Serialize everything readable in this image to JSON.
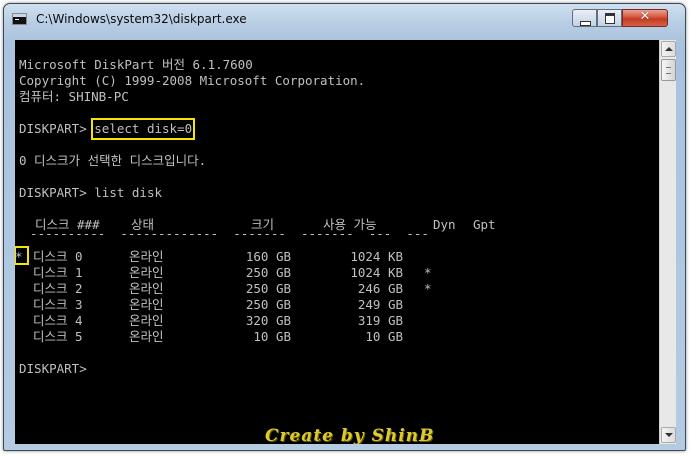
{
  "window": {
    "title": "C:\\Windows\\system32\\diskpart.exe",
    "controls": {
      "minimize": "–",
      "maximize": "□",
      "close": "✕"
    }
  },
  "console": {
    "banner": [
      "Microsoft DiskPart 버전 6.1.7600",
      "Copyright (C) 1999-2008 Microsoft Corporation.",
      "컴퓨터: SHINB-PC"
    ],
    "prompt": "DISKPART> ",
    "command_select": "select disk=0",
    "select_result": "0 디스크가 선택한 디스크입니다.",
    "command_list": "list disk",
    "columns": {
      "disk": "디스크 ###",
      "status": "상태",
      "size": "크기",
      "free": "사용 가능",
      "dyn": "Dyn",
      "gpt": "Gpt"
    },
    "separator": "  ----------  -------------  -------  -------  ---  ---",
    "rows": [
      {
        "marker": "*",
        "disk": "디스크 0",
        "status": "온라인",
        "size": "160 GB",
        "free": "1024 KB",
        "dyn": "",
        "gpt": ""
      },
      {
        "marker": " ",
        "disk": "디스크 1",
        "status": "온라인",
        "size": "250 GB",
        "free": "1024 KB",
        "dyn": "*",
        "gpt": ""
      },
      {
        "marker": " ",
        "disk": "디스크 2",
        "status": "온라인",
        "size": "250 GB",
        "free": "246 GB",
        "dyn": "*",
        "gpt": ""
      },
      {
        "marker": " ",
        "disk": "디스크 3",
        "status": "온라인",
        "size": "250 GB",
        "free": "249 GB",
        "dyn": "",
        "gpt": ""
      },
      {
        "marker": " ",
        "disk": "디스크 4",
        "status": "온라인",
        "size": "320 GB",
        "free": "319 GB",
        "dyn": "",
        "gpt": ""
      },
      {
        "marker": " ",
        "disk": "디스크 5",
        "status": "온라인",
        "size": "10 GB",
        "free": "10 GB",
        "dyn": "",
        "gpt": ""
      }
    ],
    "final_prompt": "DISKPART> "
  },
  "watermark": "Create by ShinB",
  "colors": {
    "console_bg": "#000000",
    "console_text": "#c0c0c0",
    "highlight": "#f5e600",
    "watermark": "#dccb2e"
  }
}
